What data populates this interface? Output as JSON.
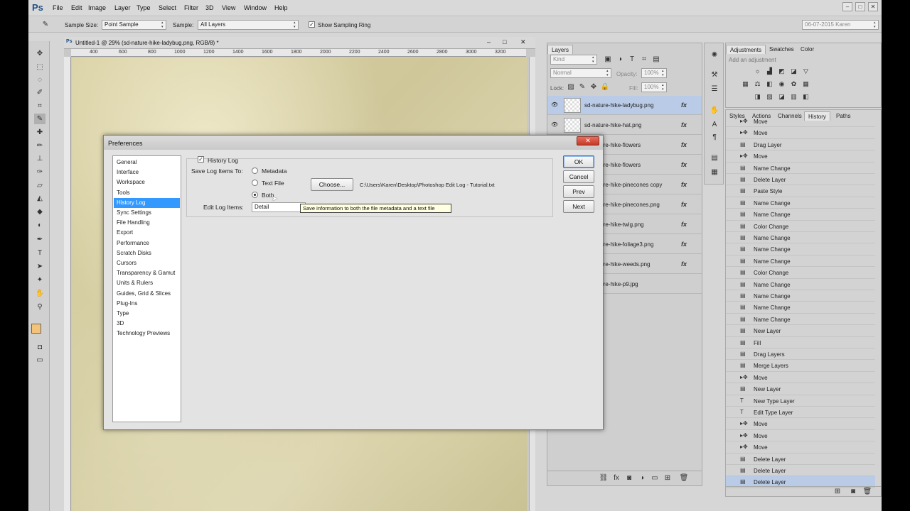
{
  "app": {
    "logo": "Ps",
    "menu": [
      "File",
      "Edit",
      "Image",
      "Layer",
      "Type",
      "Select",
      "Filter",
      "3D",
      "View",
      "Window",
      "Help"
    ],
    "window_controls": [
      "–",
      "□",
      "✕"
    ]
  },
  "options_bar": {
    "sample_size_label": "Sample Size:",
    "sample_size_value": "Point Sample",
    "sample_label": "Sample:",
    "sample_value": "All Layers",
    "show_sampling_ring_label": "Show Sampling Ring",
    "show_sampling_ring_checked": true,
    "workspace_value": "06-07-2015 Karen"
  },
  "document": {
    "title": "Untitled-1 @ 29% (sd-nature-hike-ladybug.png, RGB/8) *",
    "ruler_numbers": [
      "400",
      "600",
      "800",
      "1000",
      "1200",
      "1400",
      "1600",
      "1800",
      "2000",
      "2200",
      "2400",
      "2600",
      "2800",
      "3000",
      "3200"
    ]
  },
  "layers_panel": {
    "tab": "Layers",
    "kind_label": "Kind",
    "blend_mode": "Normal",
    "opacity_label": "Opacity:",
    "opacity_value": "100%",
    "lock_label": "Lock:",
    "fill_label": "Fill:",
    "fill_value": "100%",
    "layers": [
      {
        "name": "sd-nature-hike-ladybug.png",
        "fx": "fx",
        "selected": true
      },
      {
        "name": "sd-nature-hike-hat.png",
        "fx": "fx"
      },
      {
        "name": "sd-nature-hike-flowers",
        "fx": "fx"
      },
      {
        "name": "sd-nature-hike-flowers",
        "fx": "fx"
      },
      {
        "name": "sd-nature-hike-pinecones copy",
        "fx": "fx"
      },
      {
        "name": "sd-nature-hike-pinecones.png",
        "fx": "fx"
      },
      {
        "name": "sd-nature-hike-twig.png",
        "fx": "fx"
      },
      {
        "name": "sd-nature-hike-foliage3.png",
        "fx": "fx"
      },
      {
        "name": "sd-nature-hike-weeds.png",
        "fx": "fx"
      },
      {
        "name": "sd-nature-hike-p9.jpg",
        "fx": ""
      }
    ]
  },
  "adjustments_panel": {
    "tabs": [
      "Adjustments",
      "Swatches",
      "Color"
    ],
    "hint": "Add an adjustment"
  },
  "history_panel": {
    "tabs": [
      "Styles",
      "Actions",
      "Channels",
      "History",
      "Paths"
    ],
    "items": [
      {
        "label": "Move",
        "icon": "move"
      },
      {
        "label": "Move",
        "icon": "move"
      },
      {
        "label": "Drag Layer",
        "icon": "doc"
      },
      {
        "label": "Move",
        "icon": "move"
      },
      {
        "label": "Name Change",
        "icon": "doc"
      },
      {
        "label": "Delete Layer",
        "icon": "doc"
      },
      {
        "label": "Paste Style",
        "icon": "doc"
      },
      {
        "label": "Name Change",
        "icon": "doc"
      },
      {
        "label": "Name Change",
        "icon": "doc"
      },
      {
        "label": "Color Change",
        "icon": "doc"
      },
      {
        "label": "Name Change",
        "icon": "doc"
      },
      {
        "label": "Name Change",
        "icon": "doc"
      },
      {
        "label": "Name Change",
        "icon": "doc"
      },
      {
        "label": "Color Change",
        "icon": "doc"
      },
      {
        "label": "Name Change",
        "icon": "doc"
      },
      {
        "label": "Name Change",
        "icon": "doc"
      },
      {
        "label": "Name Change",
        "icon": "doc"
      },
      {
        "label": "Name Change",
        "icon": "doc"
      },
      {
        "label": "New Layer",
        "icon": "doc"
      },
      {
        "label": "Fill",
        "icon": "doc"
      },
      {
        "label": "Drag Layers",
        "icon": "doc"
      },
      {
        "label": "Merge Layers",
        "icon": "doc"
      },
      {
        "label": "Move",
        "icon": "move"
      },
      {
        "label": "New Layer",
        "icon": "doc"
      },
      {
        "label": "New Type Layer",
        "icon": "type"
      },
      {
        "label": "Edit Type Layer",
        "icon": "type"
      },
      {
        "label": "Move",
        "icon": "move"
      },
      {
        "label": "Move",
        "icon": "move"
      },
      {
        "label": "Move",
        "icon": "move"
      },
      {
        "label": "Delete Layer",
        "icon": "doc"
      },
      {
        "label": "Delete Layer",
        "icon": "doc"
      },
      {
        "label": "Delete Layer",
        "icon": "doc",
        "selected": true
      }
    ]
  },
  "dialog": {
    "title": "Preferences",
    "close": "✕",
    "categories": [
      "General",
      "Interface",
      "Workspace",
      "Tools",
      "History Log",
      "Sync Settings",
      "File Handling",
      "Export",
      "Performance",
      "Scratch Disks",
      "Cursors",
      "Transparency & Gamut",
      "Units & Rulers",
      "Guides, Grid & Slices",
      "Plug-Ins",
      "Type",
      "3D",
      "Technology Previews"
    ],
    "selected_category": "History Log",
    "history_log_label": "History Log",
    "history_log_checked": true,
    "save_items_label": "Save Log Items To:",
    "options": [
      "Metadata",
      "Text File",
      "Both"
    ],
    "selected_option": "Both",
    "choose_button": "Choose...",
    "file_path": "C:\\Users\\Karen\\Desktop\\Photoshop Edit Log - Tutorial.txt",
    "edit_items_label": "Edit Log Items:",
    "edit_items_value": "Detail",
    "tooltip": "Save information to both the file metadata and a text file",
    "buttons": {
      "ok": "OK",
      "cancel": "Cancel",
      "prev": "Prev",
      "next": "Next"
    }
  }
}
